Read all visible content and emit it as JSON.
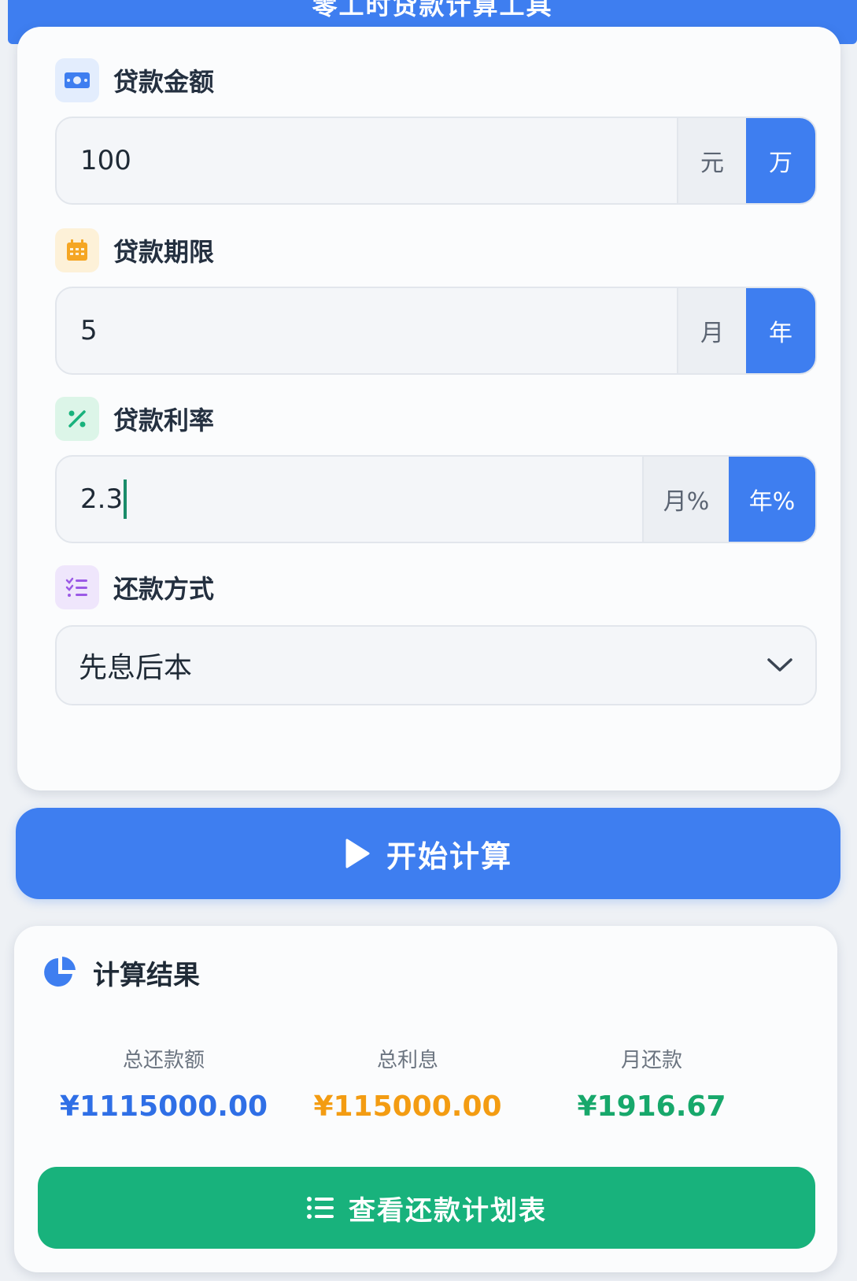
{
  "header": {
    "title": "零工时贷款计算工具"
  },
  "form": {
    "amount": {
      "label": "贷款金额",
      "value": "100",
      "units": [
        "元",
        "万"
      ],
      "selected_unit": "万"
    },
    "term": {
      "label": "贷款期限",
      "value": "5",
      "units": [
        "月",
        "年"
      ],
      "selected_unit": "年"
    },
    "rate": {
      "label": "贷款利率",
      "value": "2.3",
      "units": [
        "月%",
        "年%"
      ],
      "selected_unit": "年%"
    },
    "method": {
      "label": "还款方式",
      "value": "先息后本"
    }
  },
  "calc_button": {
    "label": "开始计算"
  },
  "result": {
    "title": "计算结果",
    "total_repayment": {
      "label": "总还款额",
      "value": "¥1115000.00"
    },
    "total_interest": {
      "label": "总利息",
      "value": "¥115000.00"
    },
    "monthly_payment": {
      "label": "月还款",
      "value": "¥1916.67"
    },
    "schedule_button": {
      "label": "查看还款计划表"
    }
  },
  "colors": {
    "primary": "#3e7ef0",
    "success": "#18b27c",
    "interest": "#f39c12",
    "monthly": "#17a86b"
  },
  "icons": {
    "amount": "money-icon",
    "term": "calendar-icon",
    "rate": "percent-icon",
    "method": "list-check-icon",
    "calc": "play-icon",
    "result": "pie-chart-icon",
    "schedule": "list-icon",
    "select": "chevron-down-icon"
  }
}
